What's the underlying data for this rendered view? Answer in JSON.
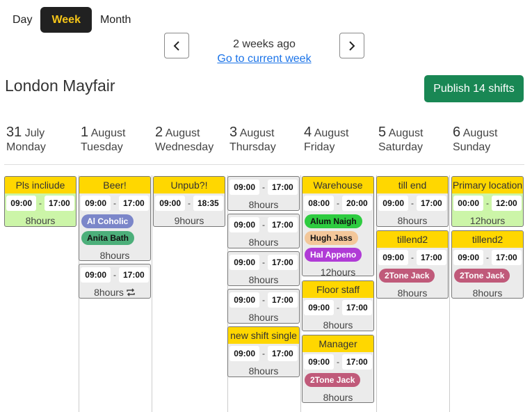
{
  "view_tabs": [
    "Day",
    "Week",
    "Month"
  ],
  "week_label": "2 weeks ago",
  "current_week_link": "Go to current week",
  "location": "London Mayfair",
  "publish_label": "Publish 14 shifts",
  "days": [
    {
      "num": "31",
      "month": "July",
      "weekday": "Monday"
    },
    {
      "num": "1",
      "month": "August",
      "weekday": "Tuesday"
    },
    {
      "num": "2",
      "month": "August",
      "weekday": "Wednesday"
    },
    {
      "num": "3",
      "month": "August",
      "weekday": "Thursday"
    },
    {
      "num": "4",
      "month": "August",
      "weekday": "Friday"
    },
    {
      "num": "5",
      "month": "August",
      "weekday": "Saturday"
    },
    {
      "num": "6",
      "month": "August",
      "weekday": "Sunday"
    }
  ],
  "shifts": {
    "mon_0": {
      "title": "Pls incliude",
      "start": "09:00",
      "end": "17:00",
      "hours": "8hours"
    },
    "tue_0": {
      "title": "Beer!",
      "start": "09:00",
      "end": "17:00",
      "hours": "8hours",
      "people": [
        "Al Coholic",
        "Anita Bath"
      ]
    },
    "tue_1": {
      "start": "09:00",
      "end": "17:00",
      "hours": "8hours"
    },
    "wed_0": {
      "title": "Unpub?!",
      "start": "09:00",
      "end": "18:35",
      "hours": "9hours"
    },
    "thu_0": {
      "start": "09:00",
      "end": "17:00",
      "hours": "8hours"
    },
    "thu_1": {
      "start": "09:00",
      "end": "17:00",
      "hours": "8hours"
    },
    "thu_2": {
      "start": "09:00",
      "end": "17:00",
      "hours": "8hours"
    },
    "thu_3": {
      "start": "09:00",
      "end": "17:00",
      "hours": "8hours"
    },
    "thu_4": {
      "title": "new shift single",
      "start": "09:00",
      "end": "17:00",
      "hours": "8hours"
    },
    "fri_0": {
      "title": "Warehouse",
      "start": "08:00",
      "end": "20:00",
      "hours": "12hours",
      "people": [
        "Alum Naigh",
        "Hugh Jass",
        "Hal Appeno"
      ]
    },
    "fri_1": {
      "title": "Floor staff",
      "start": "09:00",
      "end": "17:00",
      "hours": "8hours"
    },
    "fri_2": {
      "title": "Manager",
      "start": "09:00",
      "end": "17:00",
      "hours": "8hours",
      "people": [
        "2Tone Jack"
      ]
    },
    "sat_0": {
      "title": "till end",
      "start": "09:00",
      "end": "17:00",
      "hours": "8hours"
    },
    "sat_1": {
      "title": "tillend2",
      "start": "09:00",
      "end": "17:00",
      "hours": "8hours",
      "people": [
        "2Tone Jack"
      ]
    },
    "sun_0": {
      "title": "Primary location",
      "start": "00:00",
      "end": "12:00",
      "hours": "12hours"
    },
    "sun_1": {
      "title": "tillend2",
      "start": "09:00",
      "end": "17:00",
      "hours": "8hours",
      "people": [
        "2Tone Jack"
      ]
    }
  },
  "colors": {
    "title_bar": "#ffd700",
    "publish": "#198754",
    "active_tab_bg": "#212121",
    "active_tab_text": "#f5c518",
    "shift_green": "#ccf5a8",
    "shift_grey": "#ebebeb",
    "person_al_coholic": "#7b86c9",
    "person_anita_bath": "#4caf7a",
    "person_alum_naigh": "#2ecc40",
    "person_hugh_jass": "#f3c79a",
    "person_hal_appeno": "#b03bd6",
    "person_2tone_jack": "#c05a7a"
  },
  "icons": {
    "prev": "chevron-left-icon",
    "next": "chevron-right-icon",
    "repeat": "repeat-icon"
  }
}
